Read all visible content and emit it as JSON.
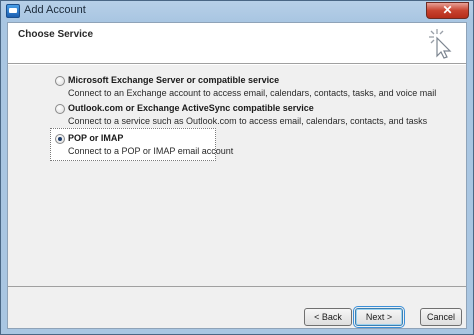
{
  "window": {
    "title": "Add Account",
    "close_label": "✕"
  },
  "header": {
    "title": "Choose Service"
  },
  "options": [
    {
      "label": "Microsoft Exchange Server or compatible service",
      "description": "Connect to an Exchange account to access email, calendars, contacts, tasks, and voice mail",
      "checked": false
    },
    {
      "label": "Outlook.com or Exchange ActiveSync compatible service",
      "description": "Connect to a service such as Outlook.com to access email, calendars, contacts, and tasks",
      "checked": false
    },
    {
      "label": "POP or IMAP",
      "description": "Connect to a POP or IMAP email account",
      "checked": true
    }
  ],
  "buttons": {
    "back": "< Back",
    "next": "Next >",
    "cancel": "Cancel"
  }
}
